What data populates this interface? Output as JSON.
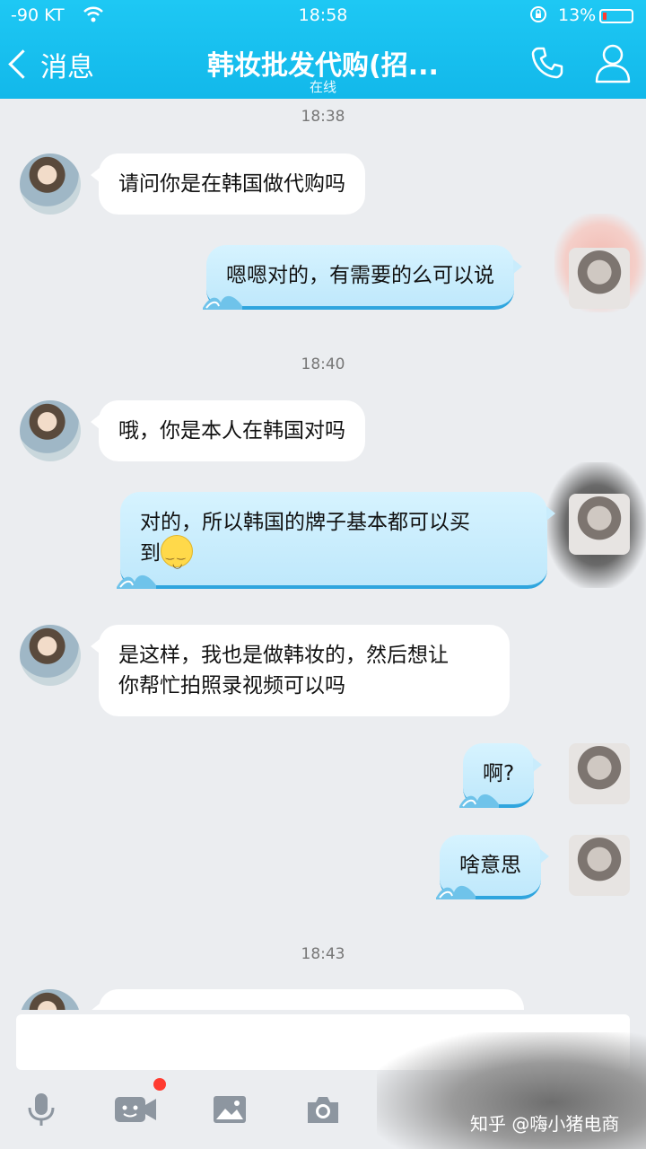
{
  "status_bar": {
    "carrier": "-90 KT",
    "time": "18:58",
    "battery_pct": "13%",
    "battery_level": 0.13,
    "battery_color": "#ff3b30"
  },
  "nav": {
    "back_label": "消息",
    "title": "韩妆批发代购(招...",
    "subtitle": "在线",
    "icons": [
      "phone-icon",
      "profile-icon"
    ],
    "accent": "#16bdee"
  },
  "messages": [
    {
      "type": "time",
      "text": "18:38"
    },
    {
      "type": "in",
      "text": "请问你是在韩国做代购吗"
    },
    {
      "type": "out",
      "text": "嗯嗯对的，有需要的么可以说"
    },
    {
      "type": "time",
      "text": "18:40"
    },
    {
      "type": "in",
      "text": "哦，你是本人在韩国对吗"
    },
    {
      "type": "out",
      "line1": "对的，所以韩国的牌子基本都可以买",
      "line2": "到",
      "emoji": "smile-emoji"
    },
    {
      "type": "in",
      "line1": "是这样，我也是做韩妆的，然后想让",
      "line2": "你帮忙拍照录视频可以吗"
    },
    {
      "type": "out",
      "text": "啊?"
    },
    {
      "type": "out",
      "text": "啥意思"
    },
    {
      "type": "time",
      "text": "18:43"
    }
  ],
  "input": {
    "placeholder": ""
  },
  "toolbar": {
    "items": [
      "microphone-icon",
      "video-call-icon",
      "image-icon",
      "camera-icon"
    ],
    "video_badge_color": "#ff3b30"
  },
  "watermark": "知乎 @嗨小猪电商"
}
